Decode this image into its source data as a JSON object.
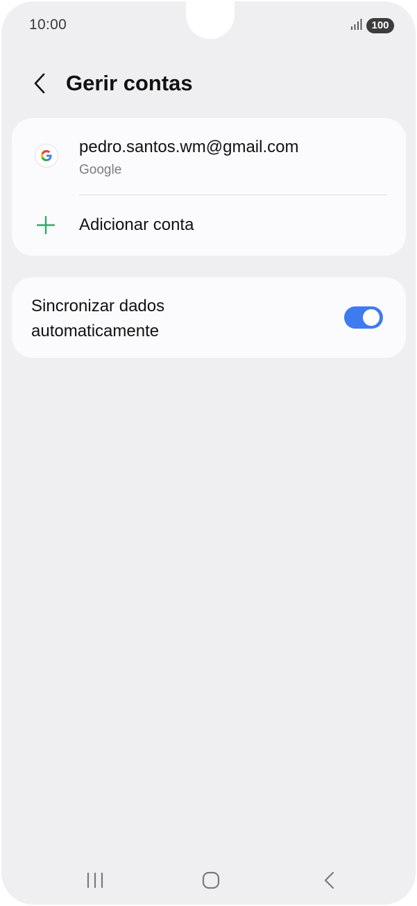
{
  "status_bar": {
    "time": "10:00",
    "battery": "100",
    "icons": [
      "signal-icon",
      "battery-icon"
    ]
  },
  "header": {
    "title": "Gerir contas",
    "back_icon": "chevron-left-icon"
  },
  "accounts": [
    {
      "email": "pedro.santos.wm@gmail.com",
      "type": "Google",
      "icon": "google-icon"
    }
  ],
  "add_account": {
    "label": "Adicionar conta",
    "icon": "plus-icon"
  },
  "sync": {
    "label": "Sincronizar dados automaticamente",
    "enabled": true
  },
  "colors": {
    "background": "#efeff1",
    "card": "#fbfbfd",
    "toggle_on": "#3e7bf0",
    "plus_icon": "#2fa86a"
  },
  "nav_bar": {
    "icons": [
      "recent-apps-icon",
      "home-icon",
      "back-icon"
    ]
  }
}
